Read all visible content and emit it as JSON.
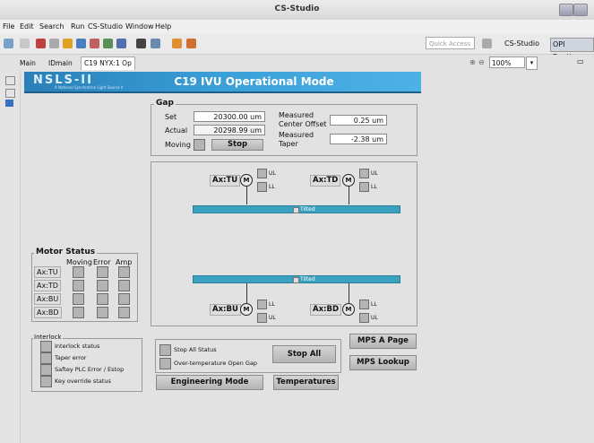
{
  "window": {
    "title": "CS-Studio"
  },
  "menu": [
    "File",
    "Edit",
    "Search",
    "Run",
    "CS-Studio",
    "Window",
    "Help"
  ],
  "toolbar": {
    "quick_access_placeholder": "Quick Access",
    "perspective_cs": "CS-Studio",
    "perspective_opi": "OPI Runtime"
  },
  "tabs": [
    {
      "label": "Main"
    },
    {
      "label": "IDmain"
    },
    {
      "label": "C19 NYX:1 Op"
    }
  ],
  "zoom": "100%",
  "banner": {
    "logo": "NSLS-II",
    "subtitle": "A National Synchrotron Light Source II",
    "title": "C19 IVU Operational Mode"
  },
  "gap": {
    "label": "Gap",
    "set_label": "Set",
    "set_value": "20300.00 um",
    "actual_label": "Actual",
    "actual_value": "20298.99 um",
    "moving_label": "Moving",
    "stop_label": "Stop",
    "center_label_1": "Measured",
    "center_label_2": "Center Offset",
    "center_value": "0.25 um",
    "taper_label_1": "Measured",
    "taper_label_2": "Taper",
    "taper_value": "-2.38 um"
  },
  "axes": {
    "tu": "Ax:TU",
    "td": "Ax:TD",
    "bu": "Ax:BU",
    "bd": "Ax:BD",
    "motor": "M",
    "ul": "UL",
    "ll": "LL",
    "tilted": "Tilted"
  },
  "motor_status": {
    "label": "Motor Status",
    "cols": [
      "Moving",
      "Error",
      "Amp"
    ],
    "rows": [
      "Ax:TU",
      "Ax:TD",
      "Ax:BU",
      "Ax:BD"
    ]
  },
  "interlock": {
    "label": "Interlock",
    "items": [
      "Interlock status",
      "Taper error",
      "Saftey PLC Error / Estop",
      "Key override status"
    ]
  },
  "bottom": {
    "stop_all_status": "Stop All Status",
    "overtemp": "Over-temperature Open Gap",
    "stop_all": "Stop All",
    "mps_a": "MPS A Page",
    "mps_lookup": "MPS Lookup",
    "eng_mode": "Engineering Mode",
    "temperatures": "Temperatures"
  },
  "colors": {
    "banner": "#3aa0d8",
    "bar": "#3aa2c0",
    "led": "#b4b4b4"
  }
}
